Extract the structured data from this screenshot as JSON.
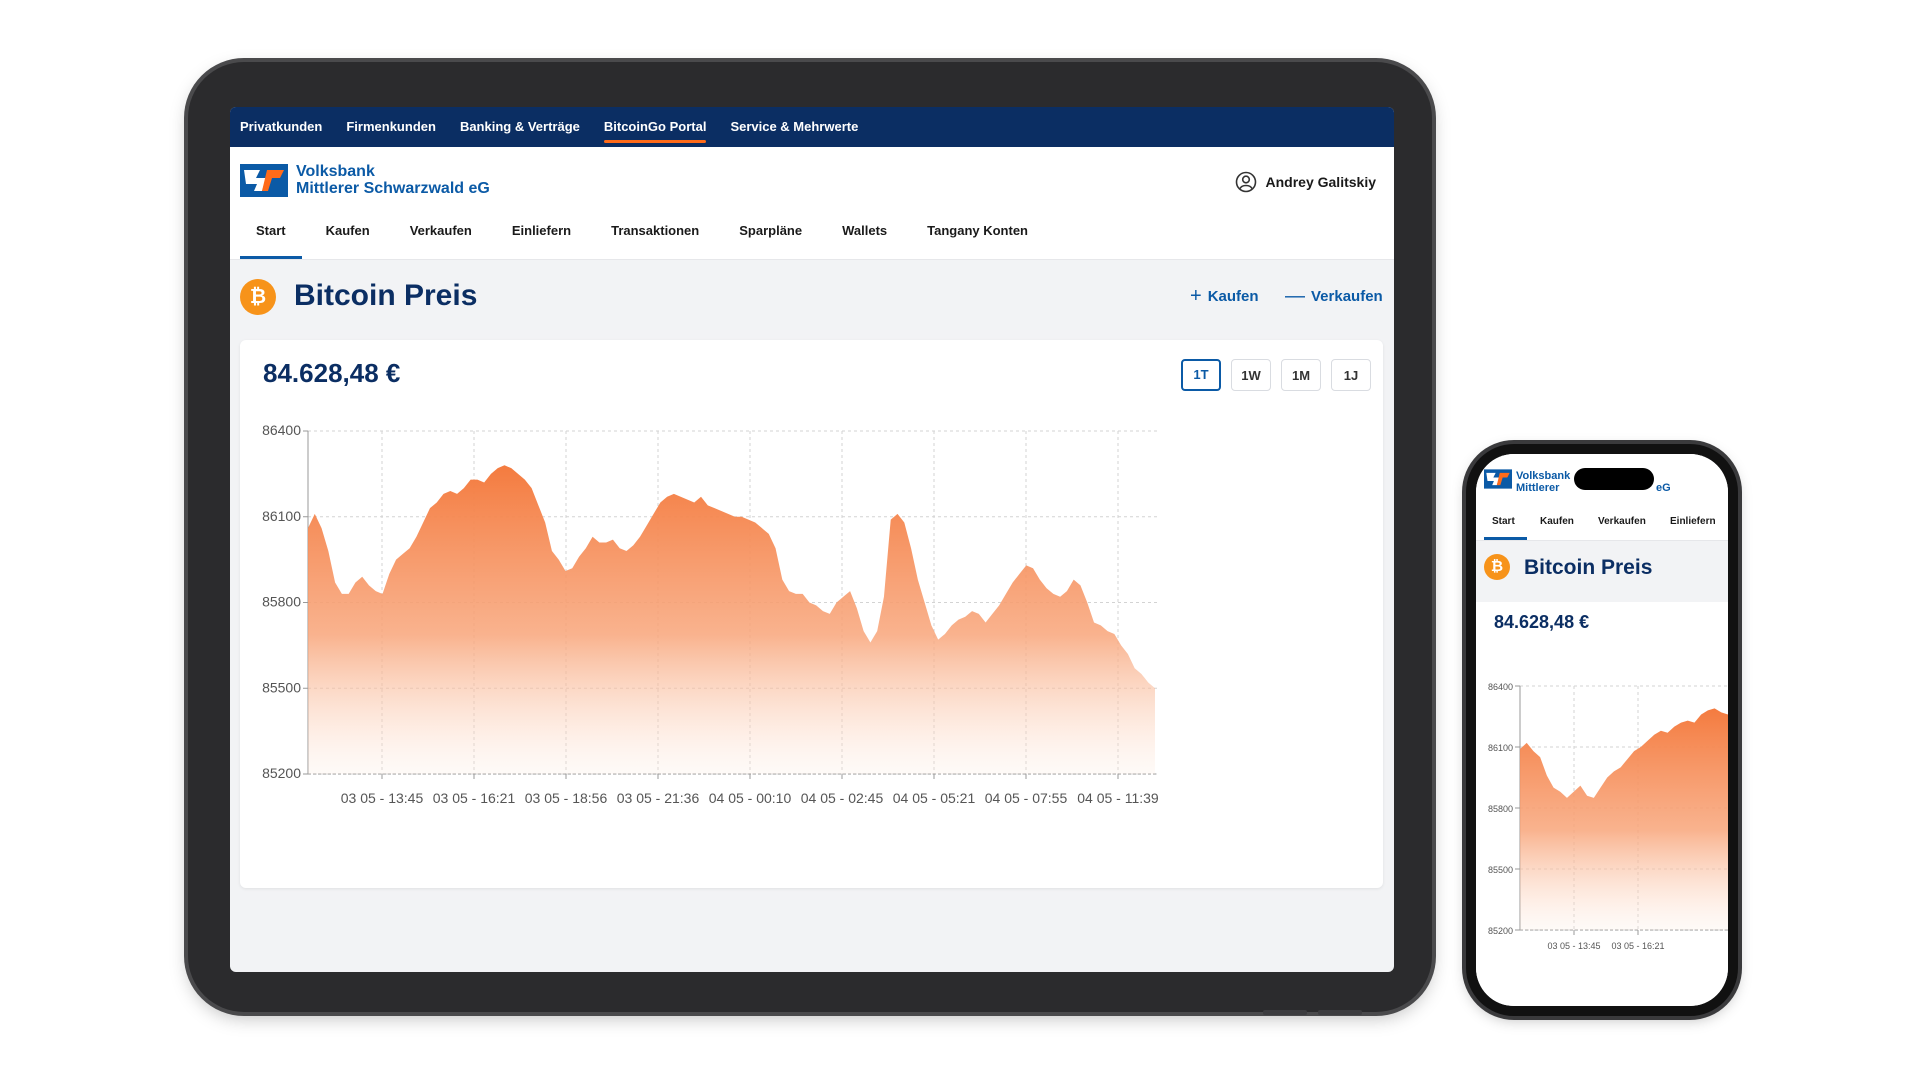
{
  "brand": {
    "name_line1": "Volksbank",
    "name_line2": "Mittlerer Schwarzwald eG",
    "phone_name_line1": "Volksbank",
    "phone_name_line2": "Mittlerer",
    "phone_name_suffix": "eG"
  },
  "topnav": {
    "items": [
      {
        "label": "Privatkunden"
      },
      {
        "label": "Firmenkunden"
      },
      {
        "label": "Banking & Verträge"
      },
      {
        "label": "BitcoinGo Portal",
        "active": true
      },
      {
        "label": "Service & Mehrwerte"
      }
    ]
  },
  "user": {
    "name": "Andrey Galitskiy",
    "icon": "user-circle-icon"
  },
  "subnav": {
    "tabs": [
      {
        "label": "Start",
        "active": true
      },
      {
        "label": "Kaufen"
      },
      {
        "label": "Verkaufen"
      },
      {
        "label": "Einliefern"
      },
      {
        "label": "Transaktionen"
      },
      {
        "label": "Sparpläne"
      },
      {
        "label": "Wallets"
      },
      {
        "label": "Tangany Konten"
      }
    ]
  },
  "page": {
    "title": "Bitcoin Preis",
    "coin_symbol": "₿",
    "actions": {
      "buy_symbol": "+",
      "buy_label": "Kaufen",
      "sell_symbol": "—",
      "sell_label": "Verkaufen"
    }
  },
  "price": {
    "current": "84.628,48 €"
  },
  "ranges": {
    "items": [
      "1T",
      "1W",
      "1M",
      "1J"
    ],
    "selected": "1T"
  },
  "colors": {
    "navy": "#0b2e63",
    "accent": "#0b5aa6",
    "orange": "#f47b3f",
    "bitcoin": "#f7931a"
  },
  "chart_data": {
    "type": "area",
    "x_ticks": [
      "03 05 - 13:45",
      "03 05 - 16:21",
      "03 05 - 18:56",
      "03 05 - 21:36",
      "04 05 - 00:10",
      "04 05 - 02:45",
      "04 05 - 05:21",
      "04 05 - 07:55",
      "04 05 - 11:39"
    ],
    "y_ticks": [
      86400,
      86100,
      85800,
      85500,
      85200
    ],
    "ylim": [
      85200,
      86400
    ],
    "grid": true,
    "series": [
      {
        "values": [
          86060,
          86110,
          86060,
          85980,
          85870,
          85830,
          85830,
          85870,
          85890,
          85860,
          85840,
          85830,
          85900,
          85950,
          85970,
          85990,
          86030,
          86080,
          86130,
          86150,
          86180,
          86190,
          86180,
          86200,
          86230,
          86230,
          86220,
          86250,
          86270,
          86280,
          86270,
          86250,
          86230,
          86200,
          86140,
          86080,
          85980,
          85950,
          85910,
          85920,
          85960,
          85990,
          86030,
          86010,
          86010,
          86020,
          85990,
          85980,
          86000,
          86030,
          86070,
          86110,
          86150,
          86170,
          86180,
          86170,
          86160,
          86150,
          86170,
          86140,
          86130,
          86120,
          86110,
          86100,
          86100,
          86090,
          86080,
          86060,
          86040,
          85990,
          85880,
          85840,
          85830,
          85830,
          85800,
          85790,
          85770,
          85760,
          85800,
          85820,
          85840,
          85780,
          85700,
          85660,
          85700,
          85820,
          86090,
          86110,
          86080,
          85990,
          85880,
          85800,
          85720,
          85670,
          85690,
          85720,
          85740,
          85750,
          85770,
          85760,
          85730,
          85760,
          85790,
          85830,
          85870,
          85900,
          85930,
          85920,
          85880,
          85850,
          85830,
          85820,
          85840,
          85880,
          85860,
          85800,
          85730,
          85720,
          85700,
          85690,
          85650,
          85620,
          85570,
          85550,
          85520,
          85500
        ]
      }
    ]
  },
  "phone_chart_data": {
    "type": "area",
    "x_ticks": [
      "03 05 - 13:45",
      "03 05 - 16:21"
    ],
    "y_ticks": [
      86400,
      86100,
      85800,
      85500,
      85200
    ],
    "ylim": [
      85200,
      86400
    ],
    "series": [
      {
        "values": [
          86090,
          86120,
          86080,
          86050,
          85960,
          85900,
          85880,
          85850,
          85880,
          85910,
          85860,
          85850,
          85900,
          85950,
          85980,
          86000,
          86040,
          86080,
          86100,
          86130,
          86160,
          86180,
          86170,
          86200,
          86220,
          86230,
          86220,
          86260,
          86280,
          86290,
          86270,
          86260
        ]
      }
    ]
  }
}
